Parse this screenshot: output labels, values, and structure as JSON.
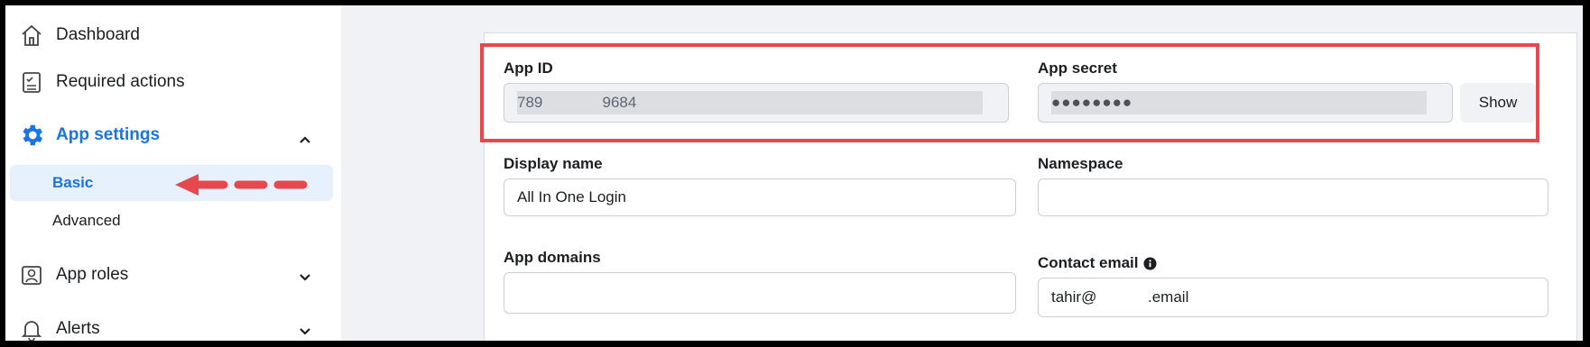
{
  "sidebar": {
    "items": [
      {
        "label": "Dashboard",
        "icon": "home-icon"
      },
      {
        "label": "Required actions",
        "icon": "checklist-icon"
      },
      {
        "label": "App settings",
        "icon": "gear-icon"
      },
      {
        "label": "App roles",
        "icon": "user-badge-icon"
      },
      {
        "label": "Alerts",
        "icon": "bell-icon"
      }
    ],
    "sub_items": [
      {
        "label": "Basic"
      },
      {
        "label": "Advanced"
      }
    ]
  },
  "form": {
    "app_id": {
      "label": "App ID",
      "value": "789              9684"
    },
    "app_secret": {
      "label": "App secret",
      "value": "●●●●●●●●",
      "show_label": "Show"
    },
    "display_name": {
      "label": "Display name",
      "value": "All In One Login"
    },
    "namespace": {
      "label": "Namespace",
      "value": ""
    },
    "app_domains": {
      "label": "App domains",
      "value": ""
    },
    "contact_email": {
      "label": "Contact email",
      "value": "tahir@            .email"
    }
  },
  "colors": {
    "accent": "#1b74e4",
    "annotation": "#e5484d"
  }
}
